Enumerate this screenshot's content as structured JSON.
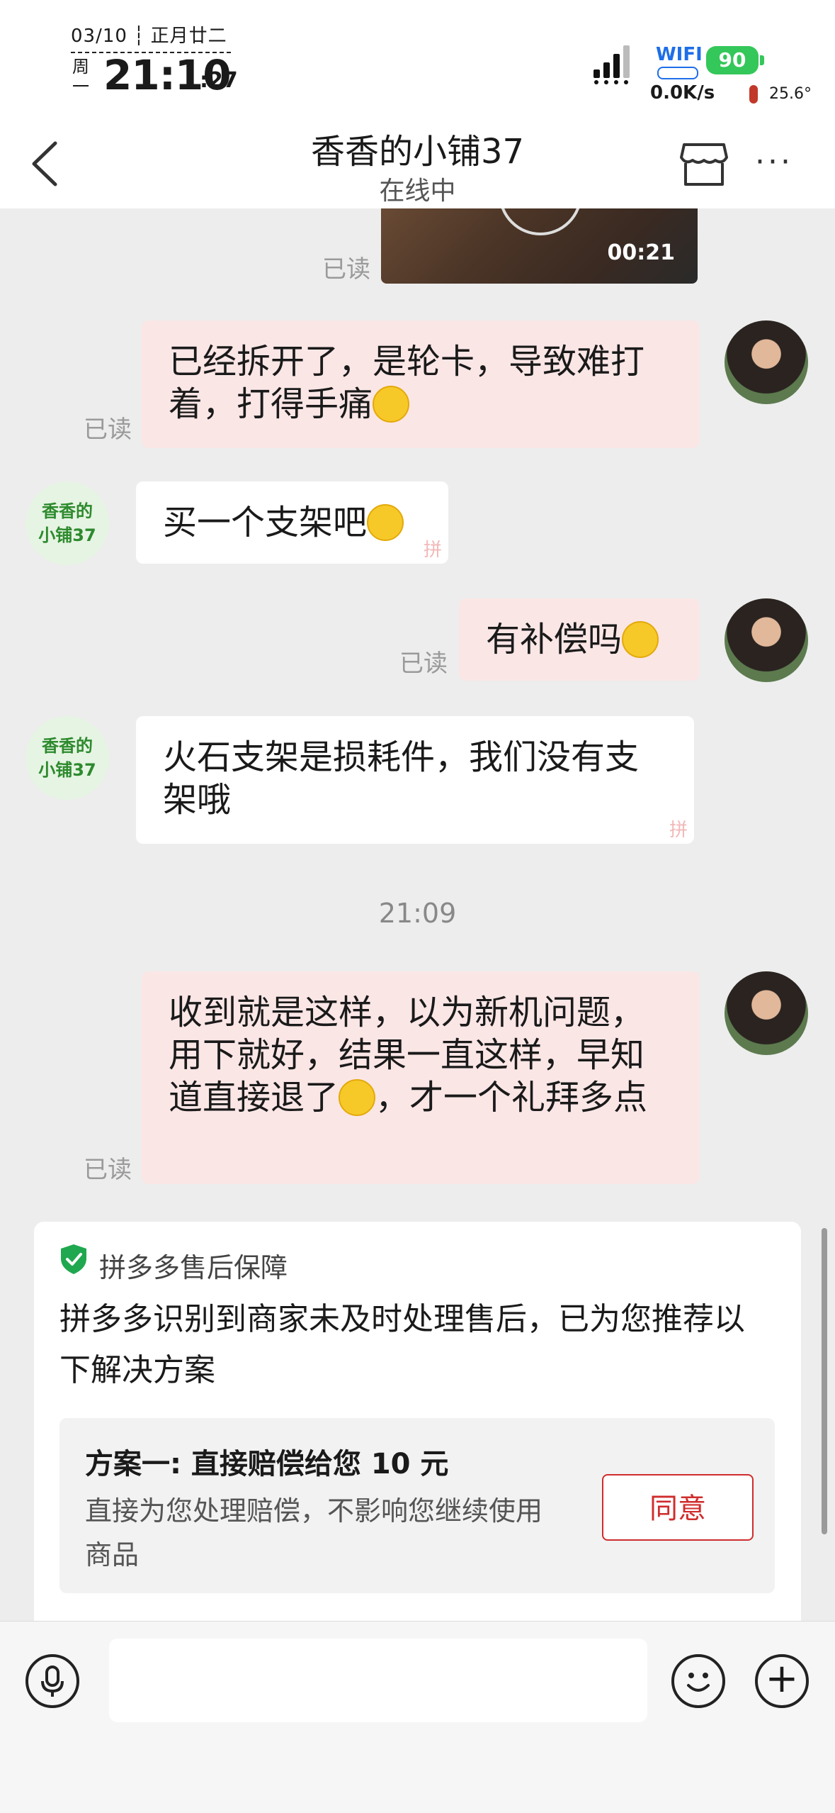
{
  "status_bar": {
    "date": "03/10",
    "lunar": "正月廿二",
    "weekday": "周一",
    "time": "21:10",
    "seconds": ":27",
    "wifi": "WIFI",
    "battery": "90",
    "net_speed": "0.0K/s",
    "temperature": "25.6°"
  },
  "header": {
    "title": "香香的小铺37",
    "status": "在线中",
    "back_icon": "chevron-left-icon",
    "store_icon": "store-icon",
    "more_icon": "more-dots-icon"
  },
  "chat": {
    "video": {
      "duration": "00:21",
      "read": "已读"
    },
    "shop_avatar_text": "香香的\n小铺37",
    "messages": [
      {
        "from": "me",
        "text": "已经拆开了，是轮卡，导致难打着，打得手痛",
        "emoji": "crying-laughing-emoji",
        "read": "已读"
      },
      {
        "from": "shop",
        "text": "买一个支架吧",
        "emoji": "crying-laughing-emoji"
      },
      {
        "from": "me",
        "text": "有补偿吗",
        "emoji": "crying-laughing-emoji",
        "read": "已读"
      },
      {
        "from": "shop",
        "text": "火石支架是损耗件，我们没有支架哦"
      },
      {
        "from": "me",
        "text_before": "收到就是这样，以为新机问题，用下就好，结果一直这样，早知道直接退了",
        "text_after": "，才一个礼拜多点",
        "emoji": "crying-laughing-emoji",
        "read": "已读"
      }
    ],
    "timestamp": "21:09"
  },
  "after_sale_card": {
    "title": "拼多多售后保障",
    "message": "拼多多识别到商家未及时处理售后，已为您推荐以下解决方案",
    "plan_one": {
      "title": "方案一: 直接赔偿给您 10 元",
      "description": "直接为您处理赔偿，不影响您继续使用商品",
      "button": "同意"
    }
  },
  "input_bar": {
    "voice_icon": "microphone-icon",
    "text_value": "",
    "emoji_icon": "smiley-icon",
    "plus_icon": "plus-icon"
  }
}
